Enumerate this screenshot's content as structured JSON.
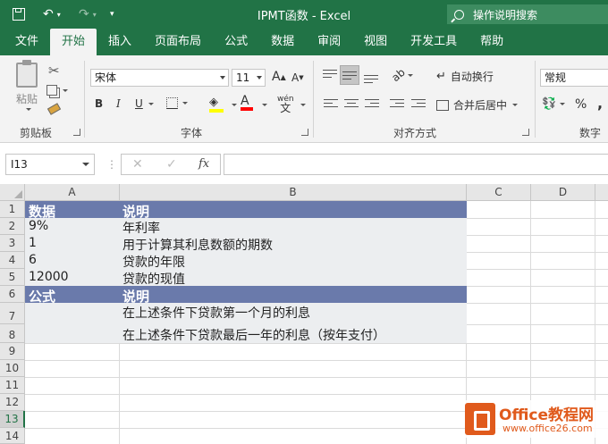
{
  "window": {
    "title": "IPMT函数 - Excel"
  },
  "tell_me": {
    "placeholder": "操作说明搜索"
  },
  "tabs": [
    "文件",
    "开始",
    "插入",
    "页面布局",
    "公式",
    "数据",
    "审阅",
    "视图",
    "开发工具",
    "帮助"
  ],
  "active_tab": "开始",
  "ribbon": {
    "clipboard": {
      "label": "剪贴板",
      "paste": "粘贴"
    },
    "font": {
      "label": "字体",
      "name": "宋体",
      "size": "11",
      "bold": "B",
      "italic": "I",
      "underline": "U",
      "grow": "A",
      "shrink": "A",
      "color": "A",
      "phonetic": "wén"
    },
    "alignment": {
      "label": "对齐方式",
      "wrap": "自动换行",
      "merge": "合并后居中"
    },
    "number": {
      "label": "数字",
      "format": "常规",
      "percent": "%",
      "comma": ","
    }
  },
  "formula_bar": {
    "name_box": "I13",
    "fx": "fx",
    "formula": ""
  },
  "columns": [
    "A",
    "B",
    "C",
    "D"
  ],
  "rows": [
    "1",
    "2",
    "3",
    "4",
    "5",
    "6",
    "7",
    "8",
    "9",
    "10",
    "11",
    "12",
    "13",
    "14"
  ],
  "cells": {
    "A1": "数据",
    "B1": "说明",
    "A2": "9%",
    "B2": "年利率",
    "A3": "1",
    "B3": "用于计算其利息数额的期数",
    "A4": "6",
    "B4": "贷款的年限",
    "A5": "12000",
    "B5": "贷款的现值",
    "A6": "公式",
    "B6": "说明",
    "B7": "在上述条件下贷款第一个月的利息",
    "B8": "在上述条件下贷款最后一年的利息（按年支付）"
  },
  "colors": {
    "ribbon_green": "#217346",
    "table_header": "#6a7aab",
    "table_body": "#eceef0"
  },
  "watermark": {
    "title": "Office教程网",
    "url": "www.office26.com"
  }
}
